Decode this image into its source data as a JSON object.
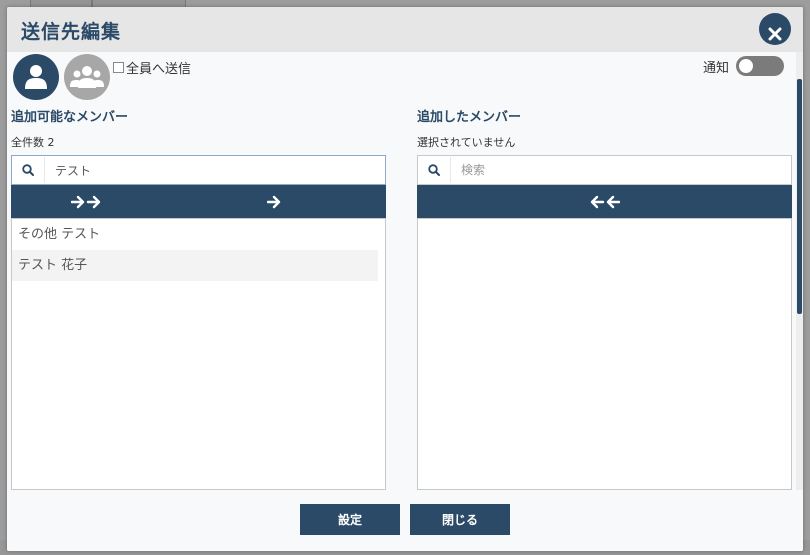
{
  "modal": {
    "title": "送信先編集",
    "close_icon": "close-icon"
  },
  "recipient_type": {
    "individual_icon": "person-icon",
    "group_icon": "group-icon",
    "send_all_label": "全員へ送信",
    "send_all_checked": false
  },
  "notify": {
    "label": "通知",
    "enabled": false
  },
  "available": {
    "title": "追加可能なメンバー",
    "count_text": "全件数 2",
    "search_value": "テスト",
    "search_placeholder": "検索",
    "add_all_icon": "double-arrow-right-icon",
    "add_selected_icon": "arrow-right-icon",
    "members": [
      {
        "name": "その他 テスト"
      },
      {
        "name": "テスト 花子"
      }
    ]
  },
  "added": {
    "title": "追加したメンバー",
    "status_text": "選択されていません",
    "search_value": "",
    "search_placeholder": "検索",
    "remove_all_icon": "double-arrow-left-icon",
    "members": []
  },
  "footer": {
    "save_label": "設定",
    "close_label": "閉じる"
  },
  "colors": {
    "primary": "#2b4a68",
    "avatar_inactive": "#a7a7a7",
    "toggle_off": "#7b7b7b"
  }
}
